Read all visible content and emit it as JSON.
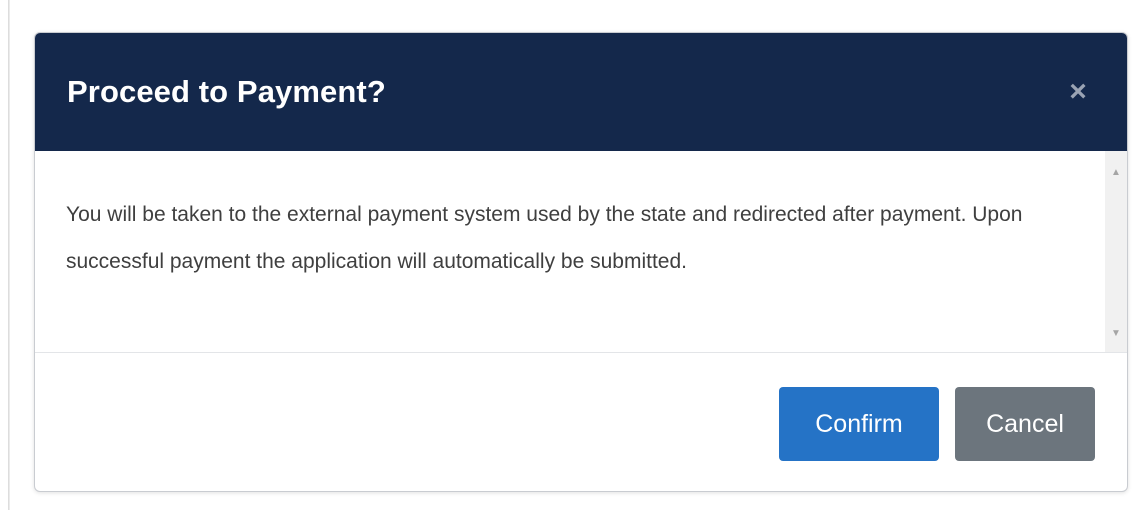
{
  "dialog": {
    "title": "Proceed to Payment?",
    "close_symbol": "×",
    "body": "You will be taken to the external payment system used by the state and redirected after payment. Upon successful payment the application will automatically be submitted.",
    "confirm_label": "Confirm",
    "cancel_label": "Cancel"
  },
  "scrollbar": {
    "up_arrow": "▲",
    "down_arrow": "▼"
  },
  "colors": {
    "header_bg": "#14284b",
    "confirm_bg": "#2573c6",
    "cancel_bg": "#6c757d"
  },
  "icons": {
    "close": "close-icon",
    "scroll_up": "scroll-up-arrow-icon",
    "scroll_down": "scroll-down-arrow-icon"
  }
}
